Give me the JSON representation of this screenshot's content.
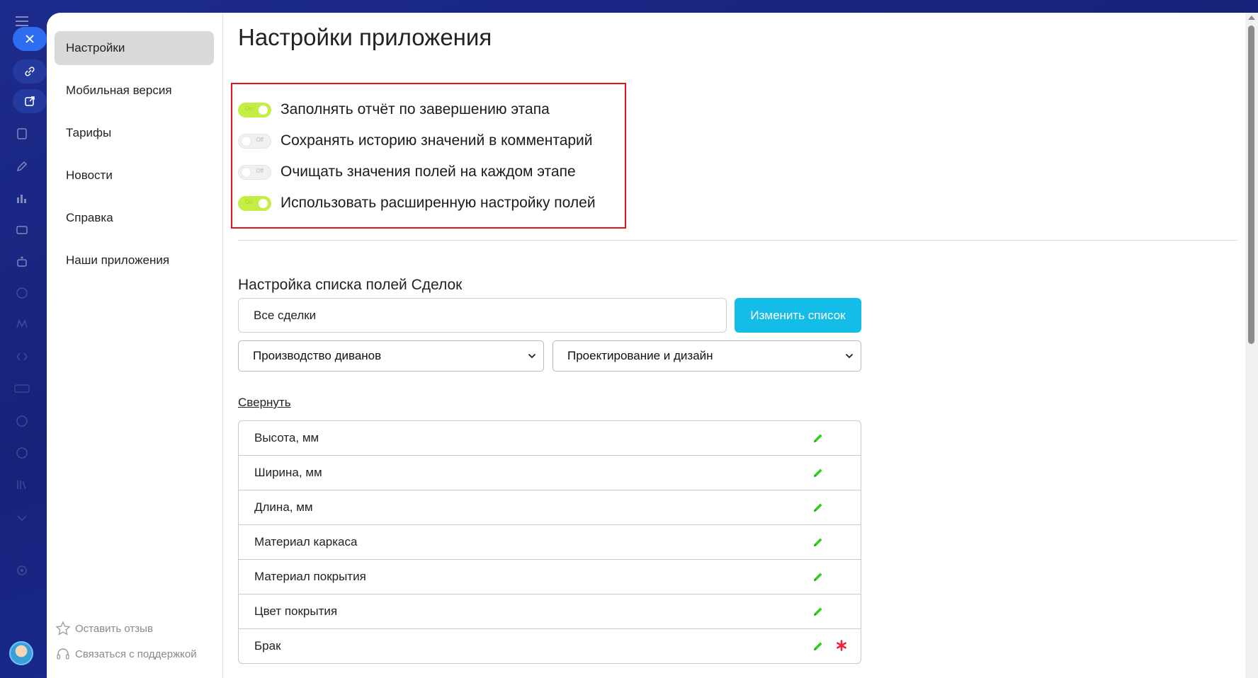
{
  "colors": {
    "toggle_on": "#c5ee44",
    "toggle_off": "#f1f1f1",
    "accent_button": "#14bde8",
    "highlight_border": "#e3131c",
    "edit_icon": "#2fcf1e",
    "required_icon": "#f0213a",
    "sidebar_active": "#d9d9d9"
  },
  "sidebar": {
    "items": [
      {
        "label": "Настройки",
        "active": true
      },
      {
        "label": "Мобильная версия",
        "active": false
      },
      {
        "label": "Тарифы",
        "active": false
      },
      {
        "label": "Новости",
        "active": false
      },
      {
        "label": "Справка",
        "active": false
      },
      {
        "label": "Наши приложения",
        "active": false
      }
    ],
    "footer": {
      "feedback_label": "Оставить отзыв",
      "support_label": "Связаться с поддержкой"
    }
  },
  "main": {
    "title": "Настройки приложения",
    "toggles": [
      {
        "label": "Заполнять отчёт по завершению этапа",
        "state": "on",
        "state_text": "On"
      },
      {
        "label": "Сохранять историю значений в комментарий",
        "state": "off",
        "state_text": "Off"
      },
      {
        "label": "Очищать значения полей на каждом этапе",
        "state": "off",
        "state_text": "Off"
      },
      {
        "label": "Использовать расширенную настройку полей",
        "state": "on",
        "state_text": "On"
      }
    ],
    "fields_section": {
      "title": "Настройка списка полей Сделок",
      "search_value": "Все сделки",
      "change_button": "Изменить список",
      "pipeline_select": "Производство диванов",
      "stage_select": "Проектирование и дизайн",
      "collapse_link": "Свернуть",
      "fields": [
        {
          "name": "Высота, мм",
          "required": false
        },
        {
          "name": "Ширина, мм",
          "required": false
        },
        {
          "name": "Длина, мм",
          "required": false
        },
        {
          "name": "Материал каркаса",
          "required": false
        },
        {
          "name": "Материал покрытия",
          "required": false
        },
        {
          "name": "Цвет покрытия",
          "required": false
        },
        {
          "name": "Брак",
          "required": true
        }
      ]
    }
  },
  "portal_strip": {
    "icons": [
      "menu-icon",
      "close-icon",
      "link-icon",
      "external-link-icon",
      "edit-icon",
      "chart-icon",
      "card-icon",
      "robot-icon",
      "box-icon",
      "code-icon",
      "book-icon",
      "chevron-down-icon",
      "gear-icon"
    ]
  }
}
